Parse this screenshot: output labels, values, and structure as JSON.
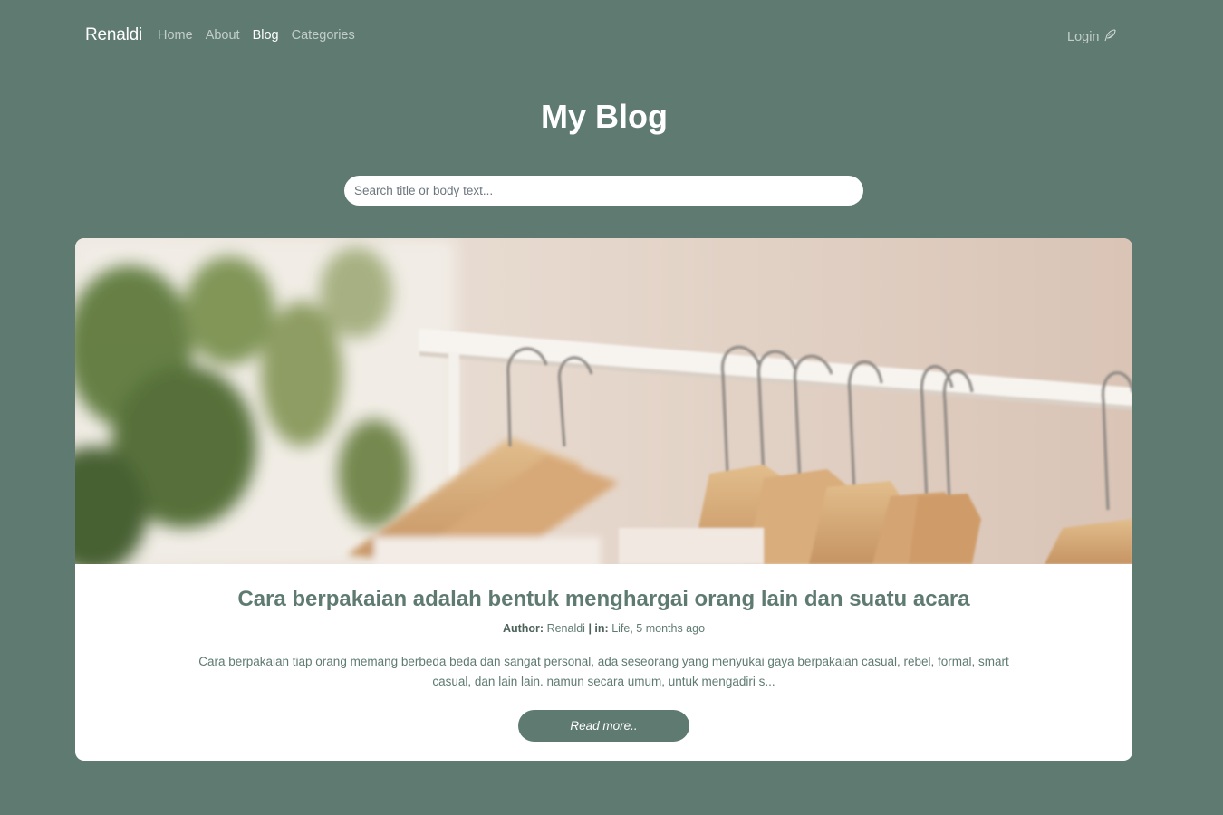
{
  "navbar": {
    "brand": "Renaldi",
    "links": [
      {
        "label": "Home",
        "active": false
      },
      {
        "label": "About",
        "active": false
      },
      {
        "label": "Blog",
        "active": true
      },
      {
        "label": "Categories",
        "active": false
      }
    ],
    "login_label": "Login",
    "login_icon": "feather-icon"
  },
  "header": {
    "title": "My Blog"
  },
  "search": {
    "placeholder": "Search title or body text...",
    "value": ""
  },
  "posts": [
    {
      "image_icon": "clothes-rack-hangers-photo",
      "title": "Cara berpakaian adalah bentuk menghargai orang lain dan suatu acara",
      "author_label": "Author:",
      "author": "Renaldi",
      "separator": "|",
      "in_label": "in:",
      "category_and_time": "Life, 5 months ago",
      "excerpt": "Cara berpakaian tiap orang memang berbeda beda dan sangat personal, ada seseorang yang menyukai gaya berpakaian casual, rebel, formal, smart casual, dan lain lain. namun secara umum, untuk mengadiri s...",
      "read_more_label": "Read more.."
    }
  ],
  "colors": {
    "background": "#5f7b71",
    "card": "#ffffff",
    "accent": "#5f7b71"
  }
}
